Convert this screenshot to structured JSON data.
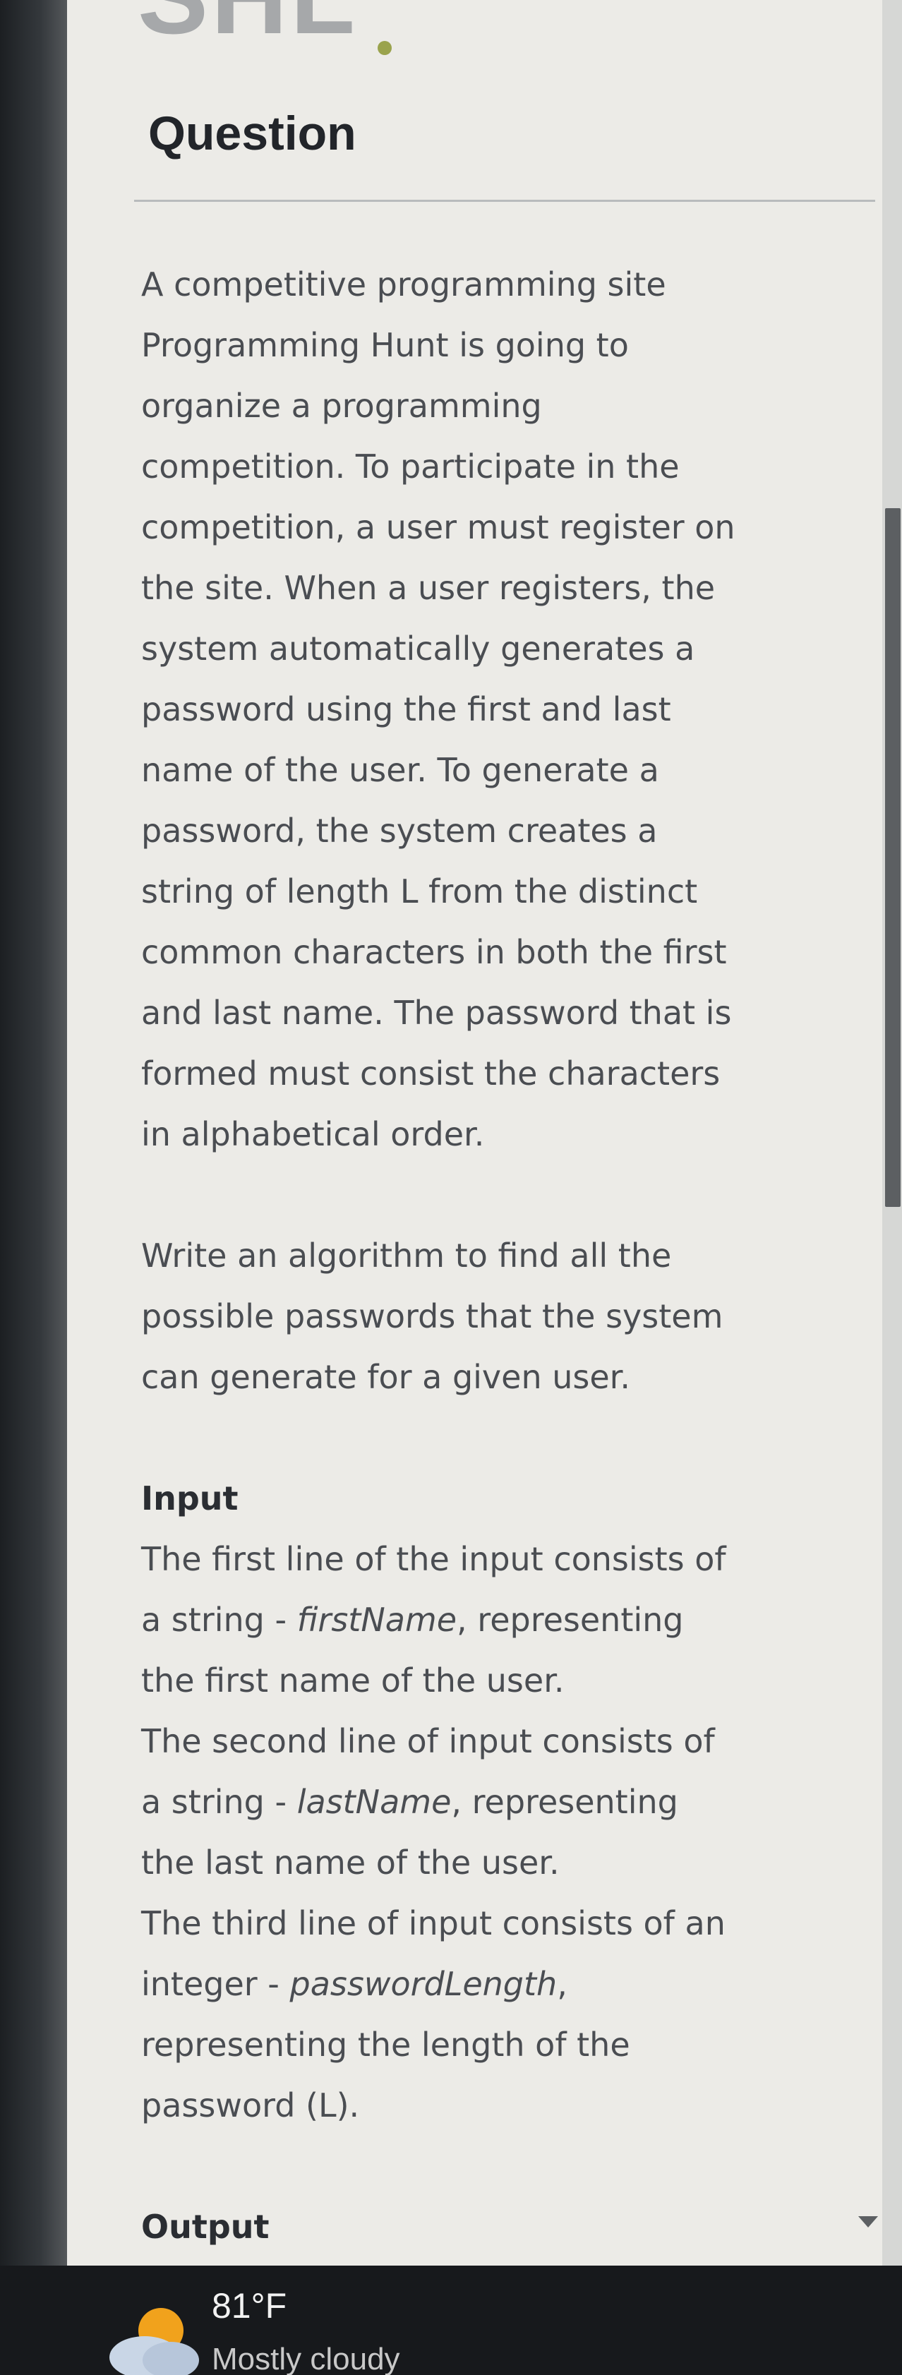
{
  "question": {
    "title": "Question",
    "paragraph1": [
      "A competitive programming site",
      "Programming Hunt is going to",
      "organize a programming",
      "competition. To participate in the",
      "competition, a user must register on",
      "the site. When a user registers, the",
      "system automatically generates a",
      "password using the first and last",
      "name of the user. To generate a",
      "password, the system creates a",
      "string of length L from the distinct",
      "common characters in both the first",
      "and last name. The password that is",
      "formed must consist the characters",
      "in alphabetical order."
    ],
    "paragraph2": [
      "Write an algorithm to find all the",
      "possible passwords that the system",
      "can generate for a given user."
    ]
  },
  "input_section": {
    "heading": "Input",
    "line1_pre": "The first line of the input consists of",
    "line2_pre": "a string - ",
    "var1": "firstName",
    "line2_post": ", representing",
    "line3": "the first name of the user.",
    "line4": "The second line of input consists of",
    "line5_pre": "a string - ",
    "var2": "lastName",
    "line5_post": ", representing",
    "line6": "the last name of the user.",
    "line7": "The third line of input consists of an",
    "line8_pre": "integer - ",
    "var3": "passwordLength",
    "line8_post": ",",
    "line9": "representing the length of the",
    "line10": "password (L)."
  },
  "output_section": {
    "heading": "Output"
  },
  "taskbar": {
    "temperature": "81°F",
    "condition": "Mostly cloudy"
  },
  "icons": {
    "weather": "partly-cloudy-icon"
  }
}
